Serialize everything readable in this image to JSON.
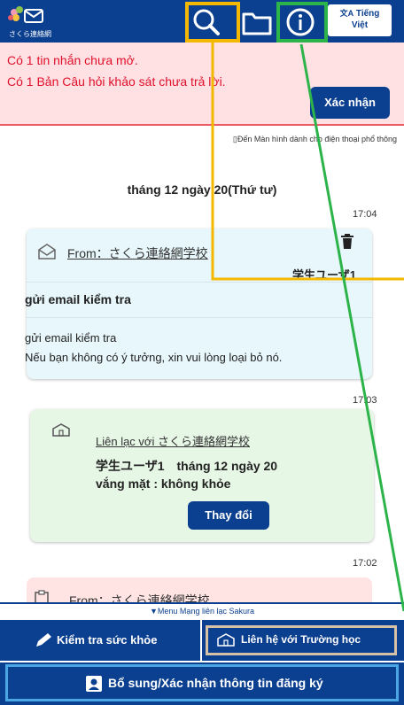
{
  "header": {
    "logo_text": "さくら連絡網",
    "lang_line1": "Tiếng",
    "lang_line2": "Việt"
  },
  "alert": {
    "line1": "Có 1 tin nhắn chưa mở.",
    "line2": "Có 1 Bản Câu hỏi khảo sát chưa trả lời.",
    "confirm_label": "Xác nhận"
  },
  "feature_phone_link": "Đến Màn hình dành cho điện thoại phổ thông",
  "date_header": "tháng 12 ngày 20(Thứ tư)",
  "messages": [
    {
      "time": "17:04",
      "from": "From：さくら連絡網学校",
      "user": "学生ユーザ1",
      "subject": "gửi email kiểm tra",
      "body_line1": "gửi email kiểm tra",
      "body_line2": "Nếu bạn không có ý tưởng, xin vui lòng loại bỏ nó."
    },
    {
      "time": "17:03",
      "contact": "Liên lạc với さくら連絡網学校",
      "line1": "学生ユーザ1　tháng 12 ngày 20",
      "line2": "vắng mặt : không khỏe",
      "change_label": "Thay đổi"
    },
    {
      "time": "17:02",
      "from": "From：さくら連絡網学校"
    }
  ],
  "menu_label": "▼Menu Mạng liên lạc Sakura",
  "tabs": {
    "health": "Kiểm tra sức khỏe",
    "contact_school": "Liên hệ với Trường học"
  },
  "bottom_button": "Bổ sung/Xác nhận thông tin đăng ký",
  "colors": {
    "primary": "#0b3f8f",
    "alert_text": "#e0102b",
    "highlight_orange": "#f5b800",
    "highlight_green": "#2cb44a"
  }
}
